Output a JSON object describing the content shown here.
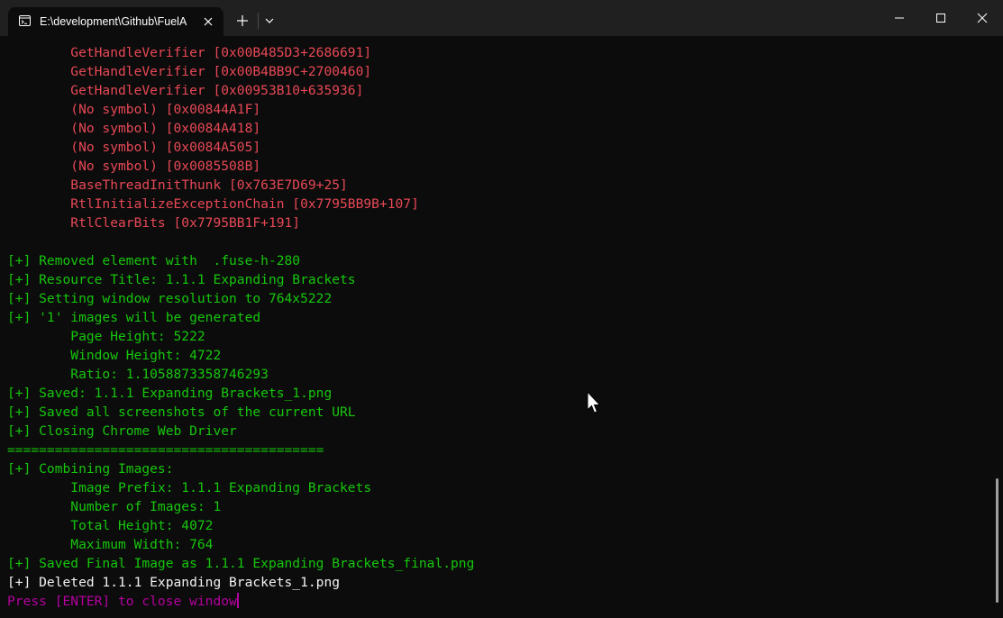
{
  "tab": {
    "title": "E:\\development\\Github\\FuelA",
    "icon": "terminal-icon"
  },
  "colors": {
    "error": "#e74856",
    "success": "#16c60c",
    "default": "#f2f2f2",
    "prompt": "#b4009e",
    "background": "#0c0c0c",
    "titlebar": "#202020"
  },
  "terminal": {
    "lines": [
      {
        "text": "        GetHandleVerifier [0x00B485D3+2686691]",
        "color": "red"
      },
      {
        "text": "        GetHandleVerifier [0x00B4BB9C+2700460]",
        "color": "red"
      },
      {
        "text": "        GetHandleVerifier [0x00953B10+635936]",
        "color": "red"
      },
      {
        "text": "        (No symbol) [0x00844A1F]",
        "color": "red"
      },
      {
        "text": "        (No symbol) [0x0084A418]",
        "color": "red"
      },
      {
        "text": "        (No symbol) [0x0084A505]",
        "color": "red"
      },
      {
        "text": "        (No symbol) [0x0085508B]",
        "color": "red"
      },
      {
        "text": "        BaseThreadInitThunk [0x763E7D69+25]",
        "color": "red"
      },
      {
        "text": "        RtlInitializeExceptionChain [0x7795BB9B+107]",
        "color": "red"
      },
      {
        "text": "        RtlClearBits [0x7795BB1F+191]",
        "color": "red"
      },
      {
        "text": "",
        "color": "white"
      },
      {
        "text": "[+] Removed element with  .fuse-h-280",
        "color": "green"
      },
      {
        "text": "[+] Resource Title: 1.1.1 Expanding Brackets",
        "color": "green"
      },
      {
        "text": "[+] Setting window resolution to 764x5222",
        "color": "green"
      },
      {
        "text": "[+] '1' images will be generated",
        "color": "green"
      },
      {
        "text": "        Page Height: 5222",
        "color": "green"
      },
      {
        "text": "        Window Height: 4722",
        "color": "green"
      },
      {
        "text": "        Ratio: 1.1058873358746293",
        "color": "green"
      },
      {
        "text": "[+] Saved: 1.1.1 Expanding Brackets_1.png",
        "color": "green"
      },
      {
        "text": "[+] Saved all screenshots of the current URL",
        "color": "green"
      },
      {
        "text": "[+] Closing Chrome Web Driver",
        "color": "green"
      },
      {
        "text": "========================================",
        "color": "green"
      },
      {
        "text": "[+] Combining Images:",
        "color": "green"
      },
      {
        "text": "        Image Prefix: 1.1.1 Expanding Brackets",
        "color": "green"
      },
      {
        "text": "        Number of Images: 1",
        "color": "green"
      },
      {
        "text": "        Total Height: 4072",
        "color": "green"
      },
      {
        "text": "        Maximum Width: 764",
        "color": "green"
      },
      {
        "text": "[+] Saved Final Image as 1.1.1 Expanding Brackets_final.png",
        "color": "green"
      },
      {
        "text": "[+] Deleted 1.1.1 Expanding Brackets_1.png",
        "color": "white"
      },
      {
        "text": "Press [ENTER] to close window",
        "color": "purple",
        "cursor": true
      }
    ]
  }
}
